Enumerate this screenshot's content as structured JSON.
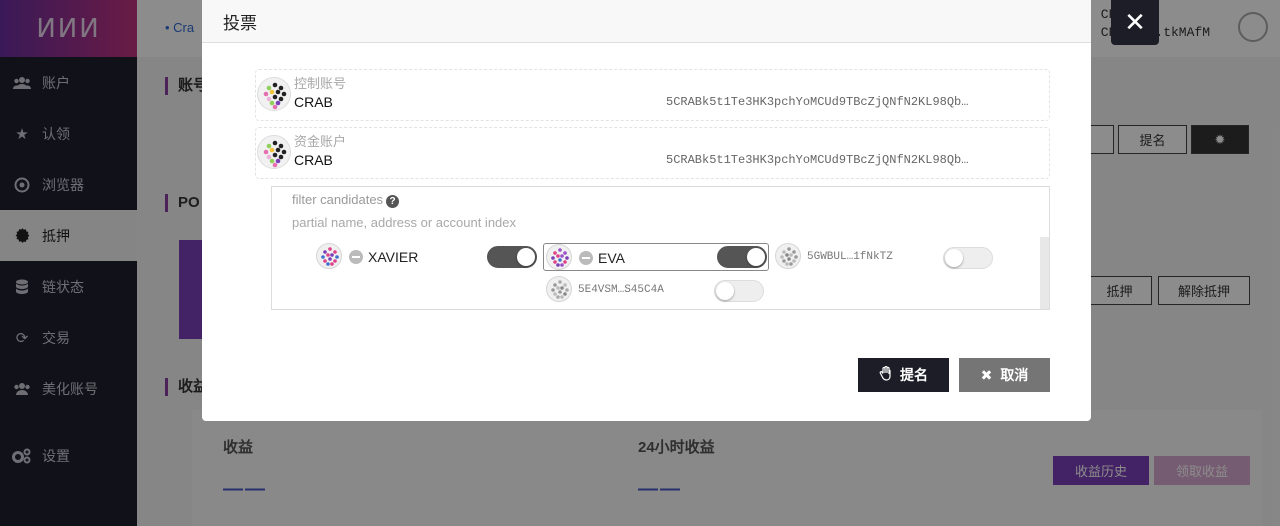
{
  "sidebar": {
    "logo": "ⵍⵍⵍ",
    "items": [
      {
        "label": "账户",
        "icon": "users-icon"
      },
      {
        "label": "认领",
        "icon": "star-icon"
      },
      {
        "label": "浏览器",
        "icon": "compass-icon"
      },
      {
        "label": "抵押",
        "icon": "gear-icon"
      },
      {
        "label": "链状态",
        "icon": "database-icon"
      },
      {
        "label": "交易",
        "icon": "sync-icon"
      },
      {
        "label": "美化账号",
        "icon": "users-icon"
      },
      {
        "label": "设置",
        "icon": "cogs-icon"
      }
    ],
    "active_index": 3
  },
  "background": {
    "crumb": "• Cra",
    "account_top_line1": "CRAB币",
    "account_top_line2": "CRABk...tkMAfM",
    "section1": "账号",
    "section2": "PO",
    "section3": "收益",
    "btn_nominate": "提名",
    "btn_settings_icon": "gear-icon",
    "btn_bond": "抵押",
    "btn_unbond": "解除抵押",
    "earn_label": "收益",
    "earn_value": "——",
    "earn24_label": "24小时收益",
    "earn24_value": "——",
    "history_btn": "收益历史",
    "claim_btn": "领取收益"
  },
  "modal": {
    "title": "投票",
    "close_icon": "close-icon",
    "controller": {
      "label": "控制账号",
      "name": "CRAB",
      "address": "5CRABk5t1Te3HK3pchYoMCUd9TBcZjQNfN2KL98Qb…"
    },
    "stash": {
      "label": "资金账户",
      "name": "CRAB",
      "address": "5CRABk5t1Te3HK3pchYoMCUd9TBcZjQNfN2KL98Qb…"
    },
    "filter": {
      "label": "filter candidates",
      "placeholder": "partial name, address or account index"
    },
    "candidates": [
      {
        "name": "XAVIER",
        "selected": true
      },
      {
        "name": "EVA",
        "selected": true
      },
      {
        "name": "5GWBUL…1fNkTZ",
        "selected": false
      },
      {
        "name": "5E4VSM…S45C4A",
        "selected": false
      }
    ],
    "nominate_label": "提名",
    "cancel_label": "取消"
  },
  "colors": {
    "sidebar_bg": "#1f1f2e",
    "logo_gradient_start": "#6a2fa0",
    "logo_gradient_end": "#c0337e",
    "accent_purple": "#7a3fb8",
    "primary_dark": "#1d1d28",
    "cancel_gray": "#757575"
  }
}
